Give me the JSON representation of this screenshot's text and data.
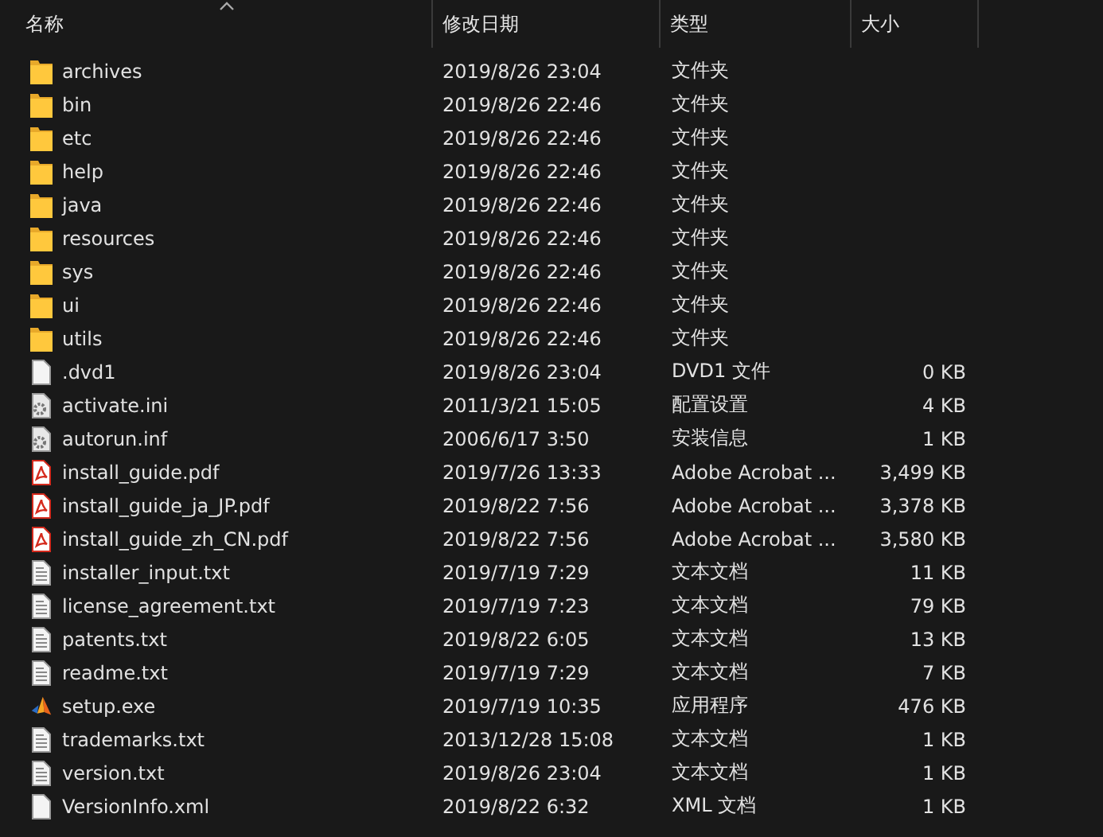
{
  "columns": [
    {
      "label": "名称",
      "sorted": true
    },
    {
      "label": "修改日期",
      "sorted": false
    },
    {
      "label": "类型",
      "sorted": false
    },
    {
      "label": "大小",
      "sorted": false
    }
  ],
  "files": [
    {
      "name": "archives",
      "kind": "folder",
      "modified": "2019/8/26 23:04",
      "type": "文件夹"
    },
    {
      "name": "bin",
      "kind": "folder",
      "modified": "2019/8/26 22:46",
      "type": "文件夹"
    },
    {
      "name": "etc",
      "kind": "folder",
      "modified": "2019/8/26 22:46",
      "type": "文件夹"
    },
    {
      "name": "help",
      "kind": "folder",
      "modified": "2019/8/26 22:46",
      "type": "文件夹"
    },
    {
      "name": "java",
      "kind": "folder",
      "modified": "2019/8/26 22:46",
      "type": "文件夹"
    },
    {
      "name": "resources",
      "kind": "folder",
      "modified": "2019/8/26 22:46",
      "type": "文件夹"
    },
    {
      "name": "sys",
      "kind": "folder",
      "modified": "2019/8/26 22:46",
      "type": "文件夹"
    },
    {
      "name": "ui",
      "kind": "folder",
      "modified": "2019/8/26 22:46",
      "type": "文件夹"
    },
    {
      "name": "utils",
      "kind": "folder",
      "modified": "2019/8/26 22:46",
      "type": "文件夹"
    },
    {
      "name": ".dvd1",
      "kind": "blank",
      "modified": "2019/8/26 23:04",
      "type": "DVD1 文件",
      "size": "0 KB"
    },
    {
      "name": "activate.ini",
      "kind": "settings",
      "modified": "2011/3/21 15:05",
      "type": "配置设置",
      "size": "4 KB"
    },
    {
      "name": "autorun.inf",
      "kind": "settings",
      "modified": "2006/6/17 3:50",
      "type": "安装信息",
      "size": "1 KB"
    },
    {
      "name": "install_guide.pdf",
      "kind": "pdf",
      "modified": "2019/7/26 13:33",
      "type": "Adobe Acrobat ...",
      "size": "3,499 KB"
    },
    {
      "name": "install_guide_ja_JP.pdf",
      "kind": "pdf",
      "modified": "2019/8/22 7:56",
      "type": "Adobe Acrobat ...",
      "size": "3,378 KB"
    },
    {
      "name": "install_guide_zh_CN.pdf",
      "kind": "pdf",
      "modified": "2019/8/22 7:56",
      "type": "Adobe Acrobat ...",
      "size": "3,580 KB"
    },
    {
      "name": "installer_input.txt",
      "kind": "text",
      "modified": "2019/7/19 7:29",
      "type": "文本文档",
      "size": "11 KB"
    },
    {
      "name": "license_agreement.txt",
      "kind": "text",
      "modified": "2019/7/19 7:23",
      "type": "文本文档",
      "size": "79 KB"
    },
    {
      "name": "patents.txt",
      "kind": "text",
      "modified": "2019/8/22 6:05",
      "type": "文本文档",
      "size": "13 KB"
    },
    {
      "name": "readme.txt",
      "kind": "text",
      "modified": "2019/7/19 7:29",
      "type": "文本文档",
      "size": "7 KB"
    },
    {
      "name": "setup.exe",
      "kind": "app",
      "modified": "2019/7/19 10:35",
      "type": "应用程序",
      "size": "476 KB"
    },
    {
      "name": "trademarks.txt",
      "kind": "text",
      "modified": "2013/12/28 15:08",
      "type": "文本文档",
      "size": "1 KB"
    },
    {
      "name": "version.txt",
      "kind": "text",
      "modified": "2019/8/26 23:04",
      "type": "文本文档",
      "size": "1 KB"
    },
    {
      "name": "VersionInfo.xml",
      "kind": "blank",
      "modified": "2019/8/22 6:32",
      "type": "XML 文档",
      "size": "1 KB"
    }
  ]
}
